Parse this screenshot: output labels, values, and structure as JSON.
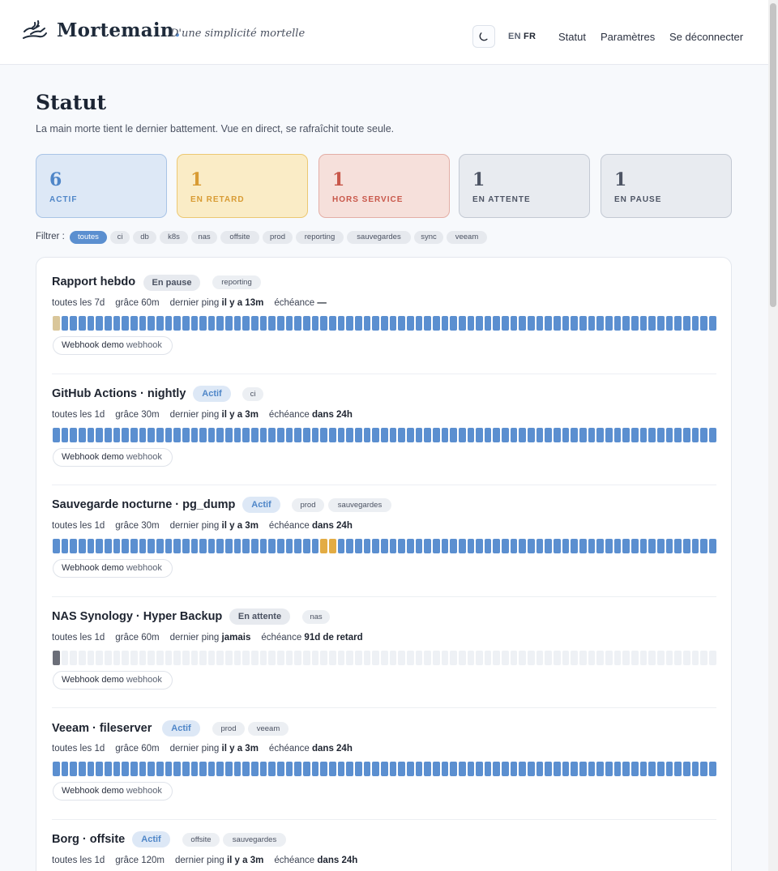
{
  "header": {
    "brand": "Mortemain",
    "brand_dot": ".",
    "tagline": "D'une simplicité mortelle",
    "lang_en": "EN",
    "lang_fr": "FR",
    "nav": {
      "statut": "Statut",
      "parametres": "Paramètres",
      "logout": "Se déconnecter"
    }
  },
  "page": {
    "title": "Statut",
    "subtitle": "La main morte tient le dernier battement. Vue en direct, se rafraîchit toute seule."
  },
  "stats": {
    "actif": {
      "count": "6",
      "label": "ACTIF"
    },
    "retard": {
      "count": "1",
      "label": "EN RETARD"
    },
    "hors": {
      "count": "1",
      "label": "HORS SERVICE"
    },
    "attente": {
      "count": "1",
      "label": "EN ATTENTE"
    },
    "pause": {
      "count": "1",
      "label": "EN PAUSE"
    }
  },
  "filter": {
    "label": "Filtrer :",
    "chips": [
      "toutes",
      "ci",
      "db",
      "k8s",
      "nas",
      "offsite",
      "prod",
      "reporting",
      "sauvegardes",
      "sync",
      "veeam"
    ],
    "active": "toutes"
  },
  "meta_keys": {
    "every": "toutes les",
    "grace": "grâce",
    "ping": "dernier ping",
    "due": "échéance"
  },
  "jobs": [
    {
      "title": "Rapport hebdo",
      "status": "En pause",
      "tags": [
        "reporting"
      ],
      "every": "7d",
      "grace": "60m",
      "ping": "il y a 13m",
      "due": "—",
      "webhook_name": "Webhook demo",
      "webhook_type": "webhook",
      "history": [
        "paused",
        "ok×76"
      ]
    },
    {
      "title": "GitHub Actions · nightly",
      "status": "Actif",
      "tags": [
        "ci"
      ],
      "every": "1d",
      "grace": "30m",
      "ping": "il y a 3m",
      "due": "dans 24h",
      "webhook_name": "Webhook demo",
      "webhook_type": "webhook",
      "history": [
        "ok×77"
      ]
    },
    {
      "title": "Sauvegarde nocturne · pg_dump",
      "status": "Actif",
      "tags": [
        "prod",
        "sauvegardes"
      ],
      "every": "1d",
      "grace": "30m",
      "ping": "il y a 3m",
      "due": "dans 24h",
      "webhook_name": "Webhook demo",
      "webhook_type": "webhook",
      "history": [
        "ok×31",
        "late×2",
        "ok×44"
      ]
    },
    {
      "title": "NAS Synology · Hyper Backup",
      "status": "En attente",
      "tags": [
        "nas"
      ],
      "every": "1d",
      "grace": "60m",
      "ping": "jamais",
      "due": "91d de retard",
      "webhook_name": "Webhook demo",
      "webhook_type": "webhook",
      "history": [
        "pending",
        "none×76"
      ]
    },
    {
      "title": "Veeam · fileserver",
      "status": "Actif",
      "tags": [
        "prod",
        "veeam"
      ],
      "every": "1d",
      "grace": "60m",
      "ping": "il y a 3m",
      "due": "dans 24h",
      "webhook_name": "Webhook demo",
      "webhook_type": "webhook",
      "history": [
        "ok×77"
      ]
    },
    {
      "title": "Borg · offsite",
      "status": "Actif",
      "tags": [
        "offsite",
        "sauvegardes"
      ],
      "every": "1d",
      "grace": "120m",
      "ping": "il y a 3m",
      "due": "dans 24h",
      "webhook_name": "",
      "webhook_type": "",
      "history": []
    }
  ],
  "colors": {
    "accent": "#5b8fd0",
    "late": "#e3ac44",
    "down": "#c8574a",
    "paused": "#d9c69a",
    "pending": "#6b6e78"
  }
}
